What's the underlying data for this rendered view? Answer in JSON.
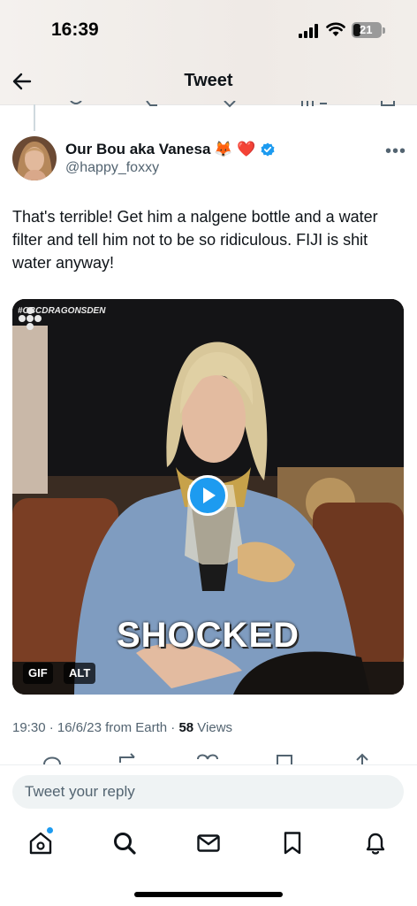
{
  "status": {
    "time": "16:39",
    "battery": "21"
  },
  "header": {
    "title": "Tweet"
  },
  "tweet": {
    "display_name": "Our Bou aka Vanesa",
    "name_emojis": "🦊 ❤️",
    "handle": "@happy_foxxy",
    "text": "That's terrible! Get him a nalgene bottle and a water filter and tell him not to be so ridiculous. FIJI is shit water anyway!",
    "media": {
      "watermark": "#CBCDRAGONSDEN",
      "caption": "SHOCKED",
      "gif_badge": "GIF",
      "alt_badge": "ALT"
    },
    "meta": {
      "timestamp": "19:30 · 16/6/23 from Earth · ",
      "views_count": "58",
      "views_label": " Views"
    }
  },
  "reply": {
    "placeholder": "Tweet your reply"
  },
  "icons": {
    "back": "arrow-left-icon",
    "more": "more-dots-icon",
    "verified": "verified-badge-icon",
    "play": "play-icon",
    "tabs": [
      "home-icon",
      "search-icon",
      "messages-icon",
      "bookmarks-icon",
      "notifications-icon"
    ]
  },
  "colors": {
    "accent": "#1d9bf0",
    "text": "#0f1419",
    "secondary": "#536471",
    "heart": "#e0245e"
  }
}
